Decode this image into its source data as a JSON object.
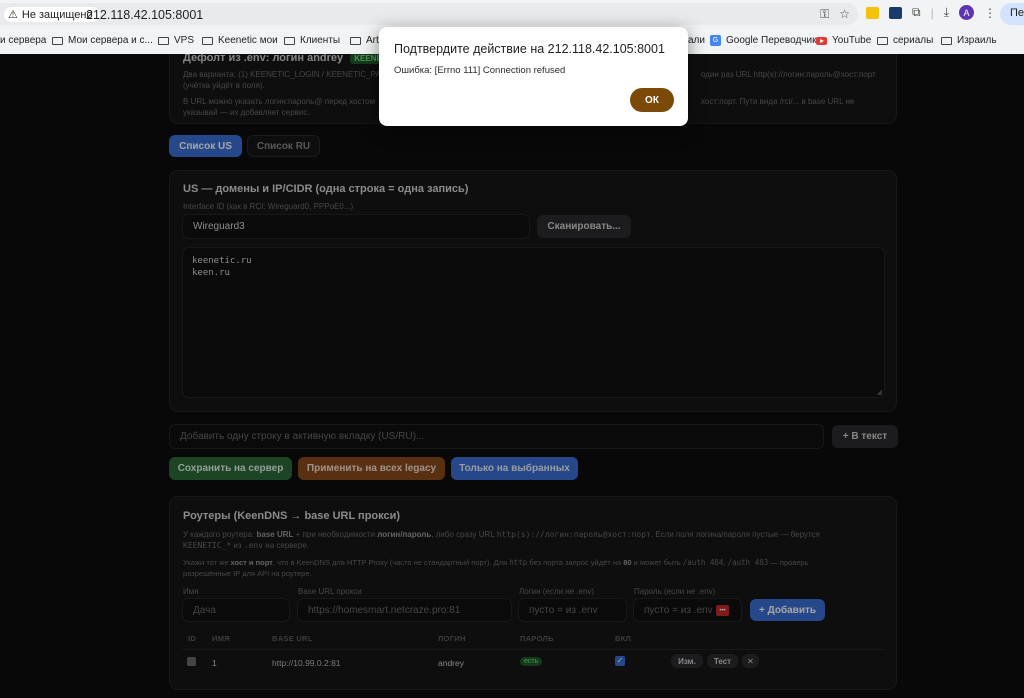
{
  "browser": {
    "security_label": "Не защищено",
    "url": "212.118.42.105:8001",
    "translate_label": "Пере",
    "avatar_letter": "A",
    "bookmarks": [
      "и сервера",
      "Мои сервера и с...",
      "VPS",
      "Keenetic мои",
      "Клиенты",
      "Arti",
      "али",
      "Google Переводчик",
      "YouTube",
      "сериалы",
      "Израиль"
    ]
  },
  "dialog": {
    "title": "Подтвердите действие на 212.118.42.105:8001",
    "message": "Ошибка: [Errno 111] Connection refused",
    "ok_label": "ОК"
  },
  "defaults_card": {
    "title_prefix": "Дефолт из .env: логин",
    "login": "andrey",
    "badge": "KEENETIC_",
    "line1": "Два варианта: (1) KEENETIC_LOGIN / KEENETIC_PASS",
    "line1_tail": "один раз URL http(s)://логин:пароль@хост:порт",
    "line1b": "(учётка уйдёт в поля).",
    "line2": "В URL можно указать логин:пароль@ перед хостом",
    "line2_tail": "хост:порт. Пути вида /rci/... в base URL не",
    "line2b": "указывай — их добавляет сервис."
  },
  "tabs": {
    "us": "Список US",
    "ru": "Список RU"
  },
  "us_card": {
    "title": "US — домены и IP/CIDR (одна строка = одна запись)",
    "interface_label": "Interface ID (как в RCI: Wireguard0, PPPoE0...)",
    "interface_value": "Wireguard3",
    "scan_label": "Сканировать...",
    "entries": [
      "keenetic.ru",
      "keen.ru"
    ]
  },
  "add_line": {
    "placeholder": "Добавить одну строку в активную вкладку (US/RU)...",
    "button": "+ В текст"
  },
  "actions": {
    "save": "Сохранить на сервер",
    "apply_legacy": "Применить на всех legacy",
    "only_selected": "Только на выбранных"
  },
  "routers": {
    "title": "Роутеры (KeenDNS → base URL прокси)",
    "desc1a": "У каждого роутера:",
    "desc1b": "base URL",
    "desc1c": "+ при необходимости",
    "desc1d": "логин/пароль",
    "desc1e": ", либо сразу URL",
    "desc1f": "http(s)://логин:пароль@хост:порт",
    "desc1g": ". Если поля логина/пароля пустые — берутся",
    "desc1h": "KEENETIC_*",
    "desc1i": "из",
    "desc1j": ".env",
    "desc1k": "на сервере.",
    "desc2a": "Укажи тот же",
    "desc2b": "хост и порт",
    "desc2c": ", что в KeenDNS для HTTP Proxy (часто не стандартный порт). Для",
    "desc2d": "http",
    "desc2e": "без порта запрос уйдёт на",
    "desc2f": "80",
    "desc2g": "и может быть",
    "desc2h": "/auth 404",
    "desc2i": ",",
    "desc2j": "/auth 403",
    "desc2k": "— проверь",
    "desc3": "разрешённые IP для API на роутере.",
    "form": {
      "name_label": "Имя",
      "name_placeholder": "Дача",
      "url_label": "Base URL прокси",
      "url_placeholder": "https://homesmart.netcraze.pro:81",
      "login_label": "Логин (если не .env)",
      "login_placeholder": "пусто = из .env",
      "pass_label": "Пароль (если не .env)",
      "pass_placeholder": "пусто = из .env",
      "add_button": "+ Добавить"
    },
    "columns": [
      "ID",
      "ИМЯ",
      "BASE URL",
      "ЛОГИН",
      "ПАРОЛЬ",
      "ВКЛ"
    ],
    "rows": [
      {
        "id": "1",
        "base_url": "http://10.99.0.2:81",
        "login": "andrey",
        "password_badge": "есть",
        "enabled": true,
        "edit": "Изм.",
        "test": "Тест",
        "delete": "✕"
      }
    ]
  },
  "colors": {
    "tab_active": "#3b6fd4",
    "save_green": "#2a6a38",
    "apply_orange": "#8a4a1c",
    "selected_blue": "#3b6fd4",
    "ok_brown": "#7a4a06",
    "badge_green": "#1f5a2a"
  }
}
